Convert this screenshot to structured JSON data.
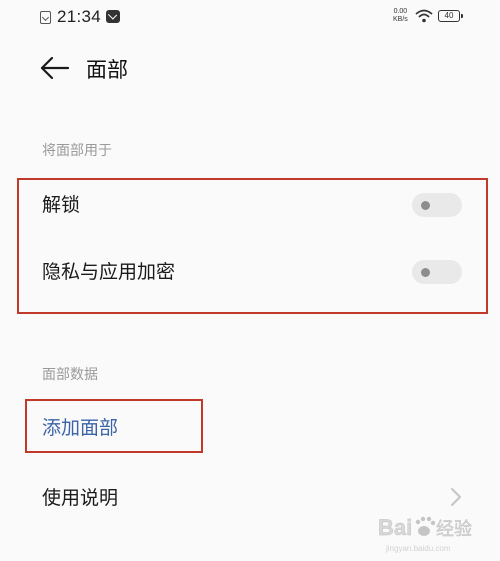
{
  "status_bar": {
    "time": "21:34",
    "net_speed_value": "0.00",
    "net_speed_unit": "KB/s",
    "battery_level": "40",
    "icons": [
      "sim-icon",
      "mail-notification-icon",
      "wifi-icon",
      "battery-icon"
    ]
  },
  "header": {
    "back_icon": "back-arrow-icon",
    "title": "面部"
  },
  "sections": {
    "use_face_for": {
      "header": "将面部用于",
      "items": [
        {
          "label": "解锁",
          "toggle_on": false
        },
        {
          "label": "隐私与应用加密",
          "toggle_on": false
        }
      ]
    },
    "face_data": {
      "header": "面部数据",
      "items": [
        {
          "label": "添加面部"
        },
        {
          "label": "使用说明",
          "icon": "chevron-right-icon"
        }
      ]
    }
  },
  "colors": {
    "background": "#fafafa",
    "accent_link": "#3b64a8",
    "highlight_box": "#c0392b",
    "toggle_track": "#e9e9e9",
    "toggle_knob": "#8d8d8d",
    "section_header": "#9a9a9a"
  }
}
